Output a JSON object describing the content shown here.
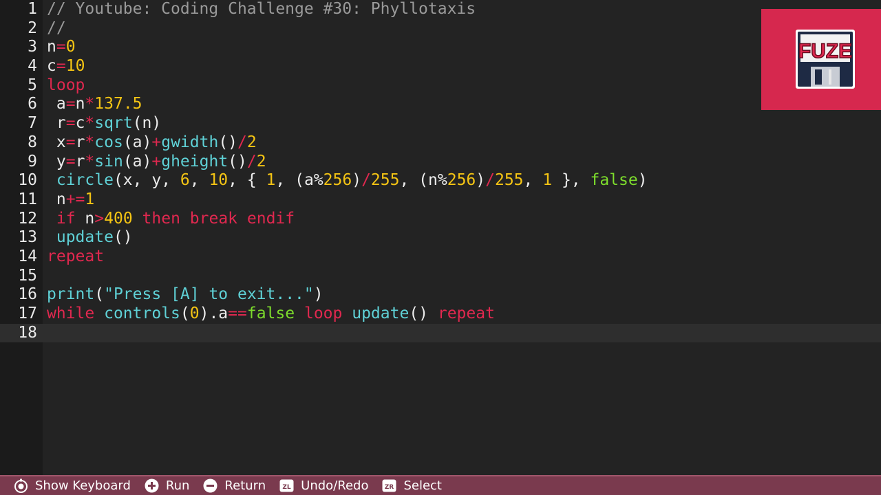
{
  "editor": {
    "current_line": 18,
    "lines": [
      {
        "n": "1",
        "tokens": [
          [
            "comment",
            "// Youtube: Coding Challenge #30: Phyllotaxis"
          ]
        ]
      },
      {
        "n": "2",
        "tokens": [
          [
            "comment",
            "//"
          ]
        ]
      },
      {
        "n": "3",
        "tokens": [
          [
            "text",
            "n"
          ],
          [
            "op",
            "="
          ],
          [
            "num",
            "0"
          ]
        ]
      },
      {
        "n": "4",
        "tokens": [
          [
            "text",
            "c"
          ],
          [
            "op",
            "="
          ],
          [
            "num",
            "10"
          ]
        ]
      },
      {
        "n": "5",
        "tokens": [
          [
            "kw",
            "loop"
          ]
        ]
      },
      {
        "n": "6",
        "tokens": [
          [
            "text",
            " a"
          ],
          [
            "op",
            "="
          ],
          [
            "text",
            "n"
          ],
          [
            "op",
            "*"
          ],
          [
            "num",
            "137.5"
          ]
        ]
      },
      {
        "n": "7",
        "tokens": [
          [
            "text",
            " r"
          ],
          [
            "op",
            "="
          ],
          [
            "text",
            "c"
          ],
          [
            "op",
            "*"
          ],
          [
            "fn",
            "sqrt"
          ],
          [
            "text",
            "(n)"
          ]
        ]
      },
      {
        "n": "8",
        "tokens": [
          [
            "text",
            " x"
          ],
          [
            "op",
            "="
          ],
          [
            "text",
            "r"
          ],
          [
            "op",
            "*"
          ],
          [
            "fn",
            "cos"
          ],
          [
            "text",
            "(a)"
          ],
          [
            "op",
            "+"
          ],
          [
            "fn",
            "gwidth"
          ],
          [
            "text",
            "()"
          ],
          [
            "op",
            "/"
          ],
          [
            "num",
            "2"
          ]
        ]
      },
      {
        "n": "9",
        "tokens": [
          [
            "text",
            " y"
          ],
          [
            "op",
            "="
          ],
          [
            "text",
            "r"
          ],
          [
            "op",
            "*"
          ],
          [
            "fn",
            "sin"
          ],
          [
            "text",
            "(a)"
          ],
          [
            "op",
            "+"
          ],
          [
            "fn",
            "gheight"
          ],
          [
            "text",
            "()"
          ],
          [
            "op",
            "/"
          ],
          [
            "num",
            "2"
          ]
        ]
      },
      {
        "n": "10",
        "tokens": [
          [
            "text",
            " "
          ],
          [
            "fn",
            "circle"
          ],
          [
            "text",
            "(x, y, "
          ],
          [
            "num",
            "6"
          ],
          [
            "text",
            ", "
          ],
          [
            "num",
            "10"
          ],
          [
            "text",
            ", { "
          ],
          [
            "num",
            "1"
          ],
          [
            "text",
            ", (a%"
          ],
          [
            "num",
            "256"
          ],
          [
            "text",
            ")"
          ],
          [
            "op",
            "/"
          ],
          [
            "num",
            "255"
          ],
          [
            "text",
            ", (n%"
          ],
          [
            "num",
            "256"
          ],
          [
            "text",
            ")"
          ],
          [
            "op",
            "/"
          ],
          [
            "num",
            "255"
          ],
          [
            "text",
            ", "
          ],
          [
            "num",
            "1"
          ],
          [
            "text",
            " }, "
          ],
          [
            "bool",
            "false"
          ],
          [
            "text",
            ")"
          ]
        ]
      },
      {
        "n": "11",
        "tokens": [
          [
            "text",
            " n"
          ],
          [
            "op",
            "+="
          ],
          [
            "num",
            "1"
          ]
        ]
      },
      {
        "n": "12",
        "tokens": [
          [
            "text",
            " "
          ],
          [
            "kw",
            "if"
          ],
          [
            "text",
            " n"
          ],
          [
            "op",
            ">"
          ],
          [
            "num",
            "400"
          ],
          [
            "text",
            " "
          ],
          [
            "kw",
            "then"
          ],
          [
            "text",
            " "
          ],
          [
            "kw",
            "break"
          ],
          [
            "text",
            " "
          ],
          [
            "kw",
            "endif"
          ]
        ]
      },
      {
        "n": "13",
        "tokens": [
          [
            "text",
            " "
          ],
          [
            "fn",
            "update"
          ],
          [
            "text",
            "()"
          ]
        ]
      },
      {
        "n": "14",
        "tokens": [
          [
            "kw",
            "repeat"
          ]
        ]
      },
      {
        "n": "15",
        "tokens": []
      },
      {
        "n": "16",
        "tokens": [
          [
            "fn",
            "print"
          ],
          [
            "text",
            "("
          ],
          [
            "str",
            "\"Press [A] to exit...\""
          ],
          [
            "text",
            ")"
          ]
        ]
      },
      {
        "n": "17",
        "tokens": [
          [
            "kw",
            "while"
          ],
          [
            "text",
            " "
          ],
          [
            "fn",
            "controls"
          ],
          [
            "text",
            "("
          ],
          [
            "num",
            "0"
          ],
          [
            "text",
            ").a"
          ],
          [
            "op",
            "=="
          ],
          [
            "bool",
            "false"
          ],
          [
            "text",
            " "
          ],
          [
            "kw",
            "loop"
          ],
          [
            "text",
            " "
          ],
          [
            "fn",
            "update"
          ],
          [
            "text",
            "() "
          ],
          [
            "kw",
            "repeat"
          ]
        ]
      },
      {
        "n": "18",
        "tokens": []
      }
    ]
  },
  "logo": {
    "text": "FUZE",
    "panel_color": "#d6284e"
  },
  "bottom_bar": {
    "hints": [
      {
        "icon": "stick-icon",
        "label": "Show Keyboard"
      },
      {
        "icon": "plus-icon",
        "label": "Run"
      },
      {
        "icon": "minus-icon",
        "label": "Return"
      },
      {
        "icon": "zl-icon",
        "label": "Undo/Redo"
      },
      {
        "icon": "zr-icon",
        "label": "Select"
      }
    ]
  }
}
